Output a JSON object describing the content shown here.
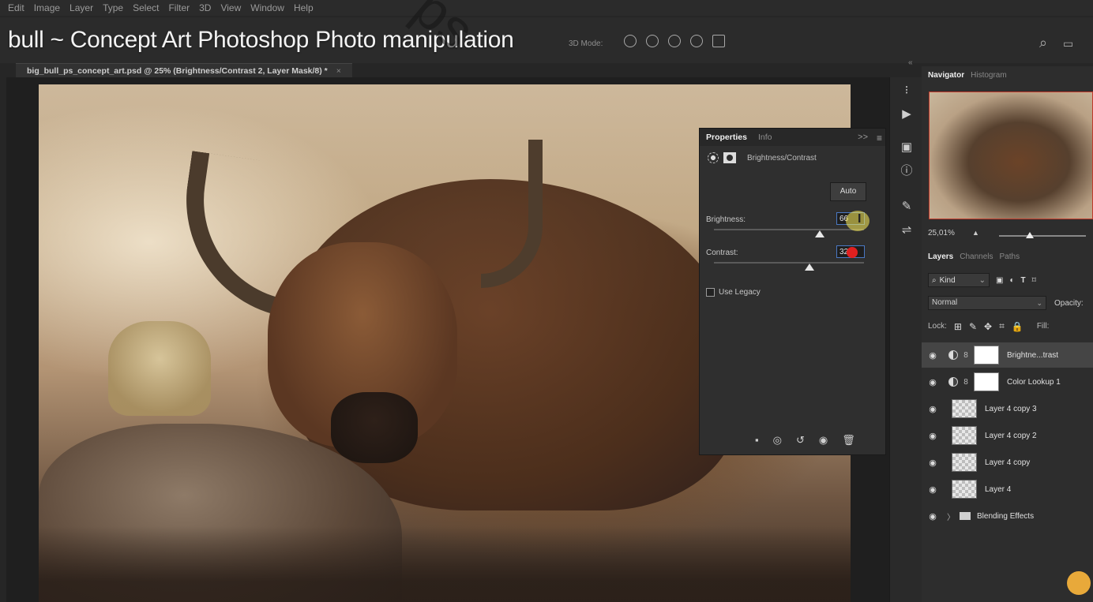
{
  "menu": [
    "Edit",
    "Image",
    "Layer",
    "Type",
    "Select",
    "Filter",
    "3D",
    "View",
    "Window",
    "Help"
  ],
  "video_title": "bull ~ Concept Art Photoshop Photo manipulation",
  "options_bar": {
    "mode_3d": "3D Mode:"
  },
  "document_tab": {
    "label": "big_bull_ps_concept_art.psd @ 25% (Brightness/Contrast 2, Layer Mask/8) *",
    "close": "×"
  },
  "properties": {
    "tabs": [
      "Properties",
      "Info"
    ],
    "collapse": ">>",
    "adjustment_name": "Brightness/Contrast",
    "auto_label": "Auto",
    "brightness_label": "Brightness:",
    "brightness_value": "66",
    "contrast_label": "Contrast:",
    "contrast_value": "32",
    "use_legacy_label": "Use Legacy"
  },
  "navigator": {
    "tabs": [
      "Navigator",
      "Histogram"
    ],
    "zoom": "25,01%"
  },
  "layers_panel": {
    "tabs": [
      "Layers",
      "Channels",
      "Paths"
    ],
    "kind_label": "Kind",
    "blend_mode": "Normal",
    "opacity_label": "Opacity:",
    "lock_label": "Lock:",
    "fill_label": "Fill:",
    "layers": [
      {
        "name": "Brightne...trast",
        "type": "adjustment",
        "selected": true
      },
      {
        "name": "Color Lookup 1",
        "type": "adjustment",
        "selected": false
      },
      {
        "name": "Layer 4 copy 3",
        "type": "pixel",
        "selected": false
      },
      {
        "name": "Layer 4 copy 2",
        "type": "pixel",
        "selected": false
      },
      {
        "name": "Layer 4 copy",
        "type": "pixel",
        "selected": false
      },
      {
        "name": "Layer 4",
        "type": "pixel",
        "selected": false
      },
      {
        "name": "Blending Effects",
        "type": "group",
        "selected": false
      }
    ]
  },
  "colors": {
    "background": "#262626",
    "panel": "#2f2f2f",
    "selection_border": "#c0392b",
    "accent_blue": "#4a78c2"
  }
}
